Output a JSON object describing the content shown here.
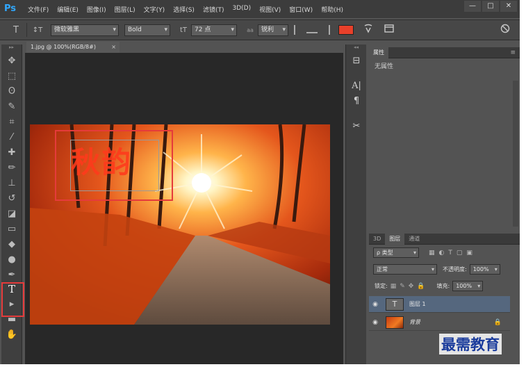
{
  "app": {
    "logo": "Ps",
    "menu": [
      "文件(F)",
      "编辑(E)",
      "图像(I)",
      "图层(L)",
      "文字(Y)",
      "选择(S)",
      "滤镜(T)",
      "3D(D)",
      "视图(V)",
      "窗口(W)",
      "帮助(H)"
    ],
    "window_controls": [
      "—",
      "□",
      "✕"
    ]
  },
  "options": {
    "tool_icon": "T",
    "orient_icon": "↕T",
    "font_family": "微软雅黑",
    "font_style": "Bold",
    "size_icon": "tT",
    "font_size": "72 点",
    "aa_icon": "aa",
    "antialias": "锐利",
    "text_color": "#e8402a",
    "warp_icon": "warp-text-icon",
    "panels_icon": "panels-icon",
    "cancel_icon": "cancel-icon"
  },
  "document": {
    "tab_title": "1.jpg @ 100%(RGB/8#)",
    "close": "×",
    "canvas_text": "秋韵"
  },
  "properties": {
    "tab": "属性",
    "menu": "≡",
    "body": "无属性"
  },
  "layers": {
    "tabs": [
      "3D",
      "图层",
      "通道"
    ],
    "filter_kind": "ρ 类型",
    "blend_mode": "正常",
    "opacity_label": "不透明度:",
    "opacity": "100%",
    "lock_label": "锁定:",
    "fill_label": "填充:",
    "fill": "100%",
    "items": [
      {
        "name": "图层 1",
        "thumb": "T"
      },
      {
        "name": "背景"
      }
    ]
  },
  "watermark": "最需教育"
}
